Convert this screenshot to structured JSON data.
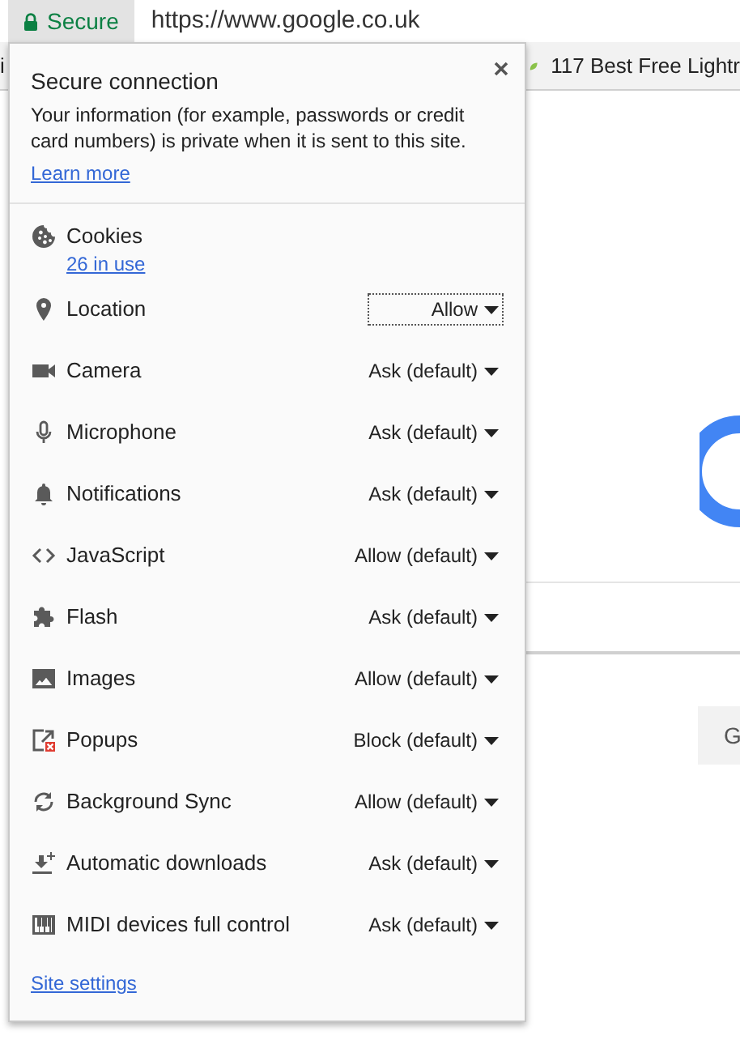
{
  "address_bar": {
    "secure_label": "Secure",
    "url": "https://www.google.co.uk"
  },
  "bookmarks_bar": {
    "left_fragment": "i",
    "item": "117 Best Free Lightr"
  },
  "popup": {
    "title": "Secure connection",
    "description": "Your information (for example, passwords or credit card numbers) is private when it is sent to this site.",
    "learn_more": "Learn more",
    "permissions": [
      {
        "kind": "usage",
        "label": "Cookies",
        "usage": "26 in use"
      },
      {
        "kind": "select",
        "label": "Location",
        "value": "Allow",
        "focused": true
      },
      {
        "kind": "select",
        "label": "Camera",
        "value": "Ask (default)",
        "focused": false
      },
      {
        "kind": "select",
        "label": "Microphone",
        "value": "Ask (default)",
        "focused": false
      },
      {
        "kind": "select",
        "label": "Notifications",
        "value": "Ask (default)",
        "focused": false
      },
      {
        "kind": "select",
        "label": "JavaScript",
        "value": "Allow (default)",
        "focused": false
      },
      {
        "kind": "select",
        "label": "Flash",
        "value": "Ask (default)",
        "focused": false
      },
      {
        "kind": "select",
        "label": "Images",
        "value": "Allow (default)",
        "focused": false
      },
      {
        "kind": "select",
        "label": "Popups",
        "value": "Block (default)",
        "focused": false
      },
      {
        "kind": "select",
        "label": "Background Sync",
        "value": "Allow (default)",
        "focused": false
      },
      {
        "kind": "select",
        "label": "Automatic downloads",
        "value": "Ask (default)",
        "focused": false
      },
      {
        "kind": "select",
        "label": "MIDI devices full control",
        "value": "Ask (default)",
        "focused": false
      }
    ],
    "site_settings": "Site settings"
  },
  "page": {
    "button_fragment": "G"
  }
}
